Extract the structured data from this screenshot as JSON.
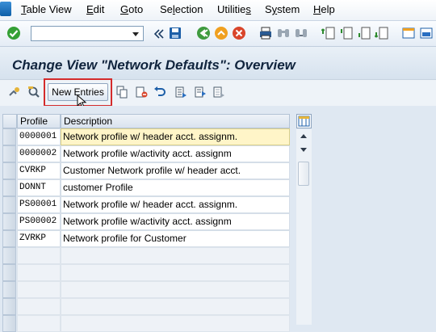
{
  "menubar": {
    "items": [
      {
        "pre": "",
        "ul": "T",
        "post": "able View"
      },
      {
        "pre": "",
        "ul": "E",
        "post": "dit"
      },
      {
        "pre": "",
        "ul": "G",
        "post": "oto"
      },
      {
        "pre": "Se",
        "ul": "l",
        "post": "ection"
      },
      {
        "pre": "Utilitie",
        "ul": "s",
        "post": ""
      },
      {
        "pre": "S",
        "ul": "y",
        "post": "stem"
      },
      {
        "pre": "",
        "ul": "H",
        "post": "elp"
      }
    ]
  },
  "command_field": {
    "value": ""
  },
  "title": "Change View \"Network Defaults\": Overview",
  "app_toolbar": {
    "new_entries_label": "New Entries"
  },
  "table": {
    "headers": {
      "profile": "Profile",
      "description": "Description"
    },
    "rows": [
      {
        "profile": "0000001",
        "description": "Network profile w/ header acct. assignm."
      },
      {
        "profile": "0000002",
        "description": "Network profile w/activity acct. assignm"
      },
      {
        "profile": "CVRKP",
        "description": "Customer Network profile w/ header acct."
      },
      {
        "profile": "DONNT",
        "description": "customer Profile"
      },
      {
        "profile": "PS00001",
        "description": "Network profile w/ header acct. assignm."
      },
      {
        "profile": "PS00002",
        "description": "Network profile w/activity acct. assignm"
      },
      {
        "profile": "ZVRKP",
        "description": "Network profile for Customer"
      }
    ]
  },
  "colors": {
    "highlight_outline": "#d42b2b",
    "selected_cell": "#fff5c8"
  }
}
